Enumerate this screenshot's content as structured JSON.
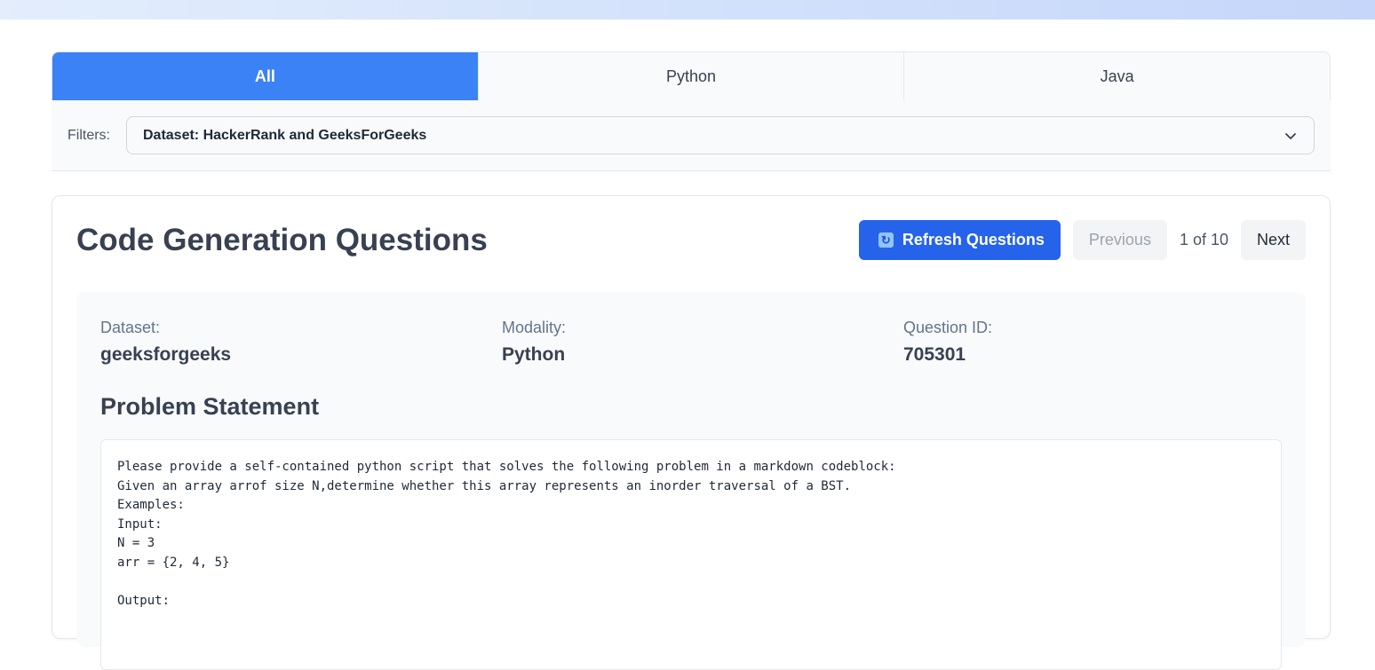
{
  "tabs": [
    {
      "label": "All",
      "active": true
    },
    {
      "label": "Python",
      "active": false
    },
    {
      "label": "Java",
      "active": false
    }
  ],
  "filters": {
    "label": "Filters:",
    "selected": "Dataset: HackerRank and GeeksForGeeks"
  },
  "card": {
    "title": "Code Generation Questions",
    "refresh_label": "Refresh Questions",
    "prev_label": "Previous",
    "pager_text": "1 of 10",
    "next_label": "Next"
  },
  "meta": {
    "dataset_label": "Dataset:",
    "dataset_value": "geeksforgeeks",
    "modality_label": "Modality:",
    "modality_value": "Python",
    "qid_label": "Question ID:",
    "qid_value": "705301"
  },
  "problem": {
    "title": "Problem Statement",
    "lines": [
      "Please provide a self-contained python script that solves the following problem in a markdown codeblock:",
      "Given an array arrof size N,determine whether this array represents an inorder traversal of a BST.",
      "Examples:",
      "Input:",
      "N = 3",
      "arr = {2, 4, 5}",
      "",
      "Output:"
    ]
  },
  "colors": {
    "accent": "#3b82f6",
    "primary_button": "#2563eb"
  }
}
